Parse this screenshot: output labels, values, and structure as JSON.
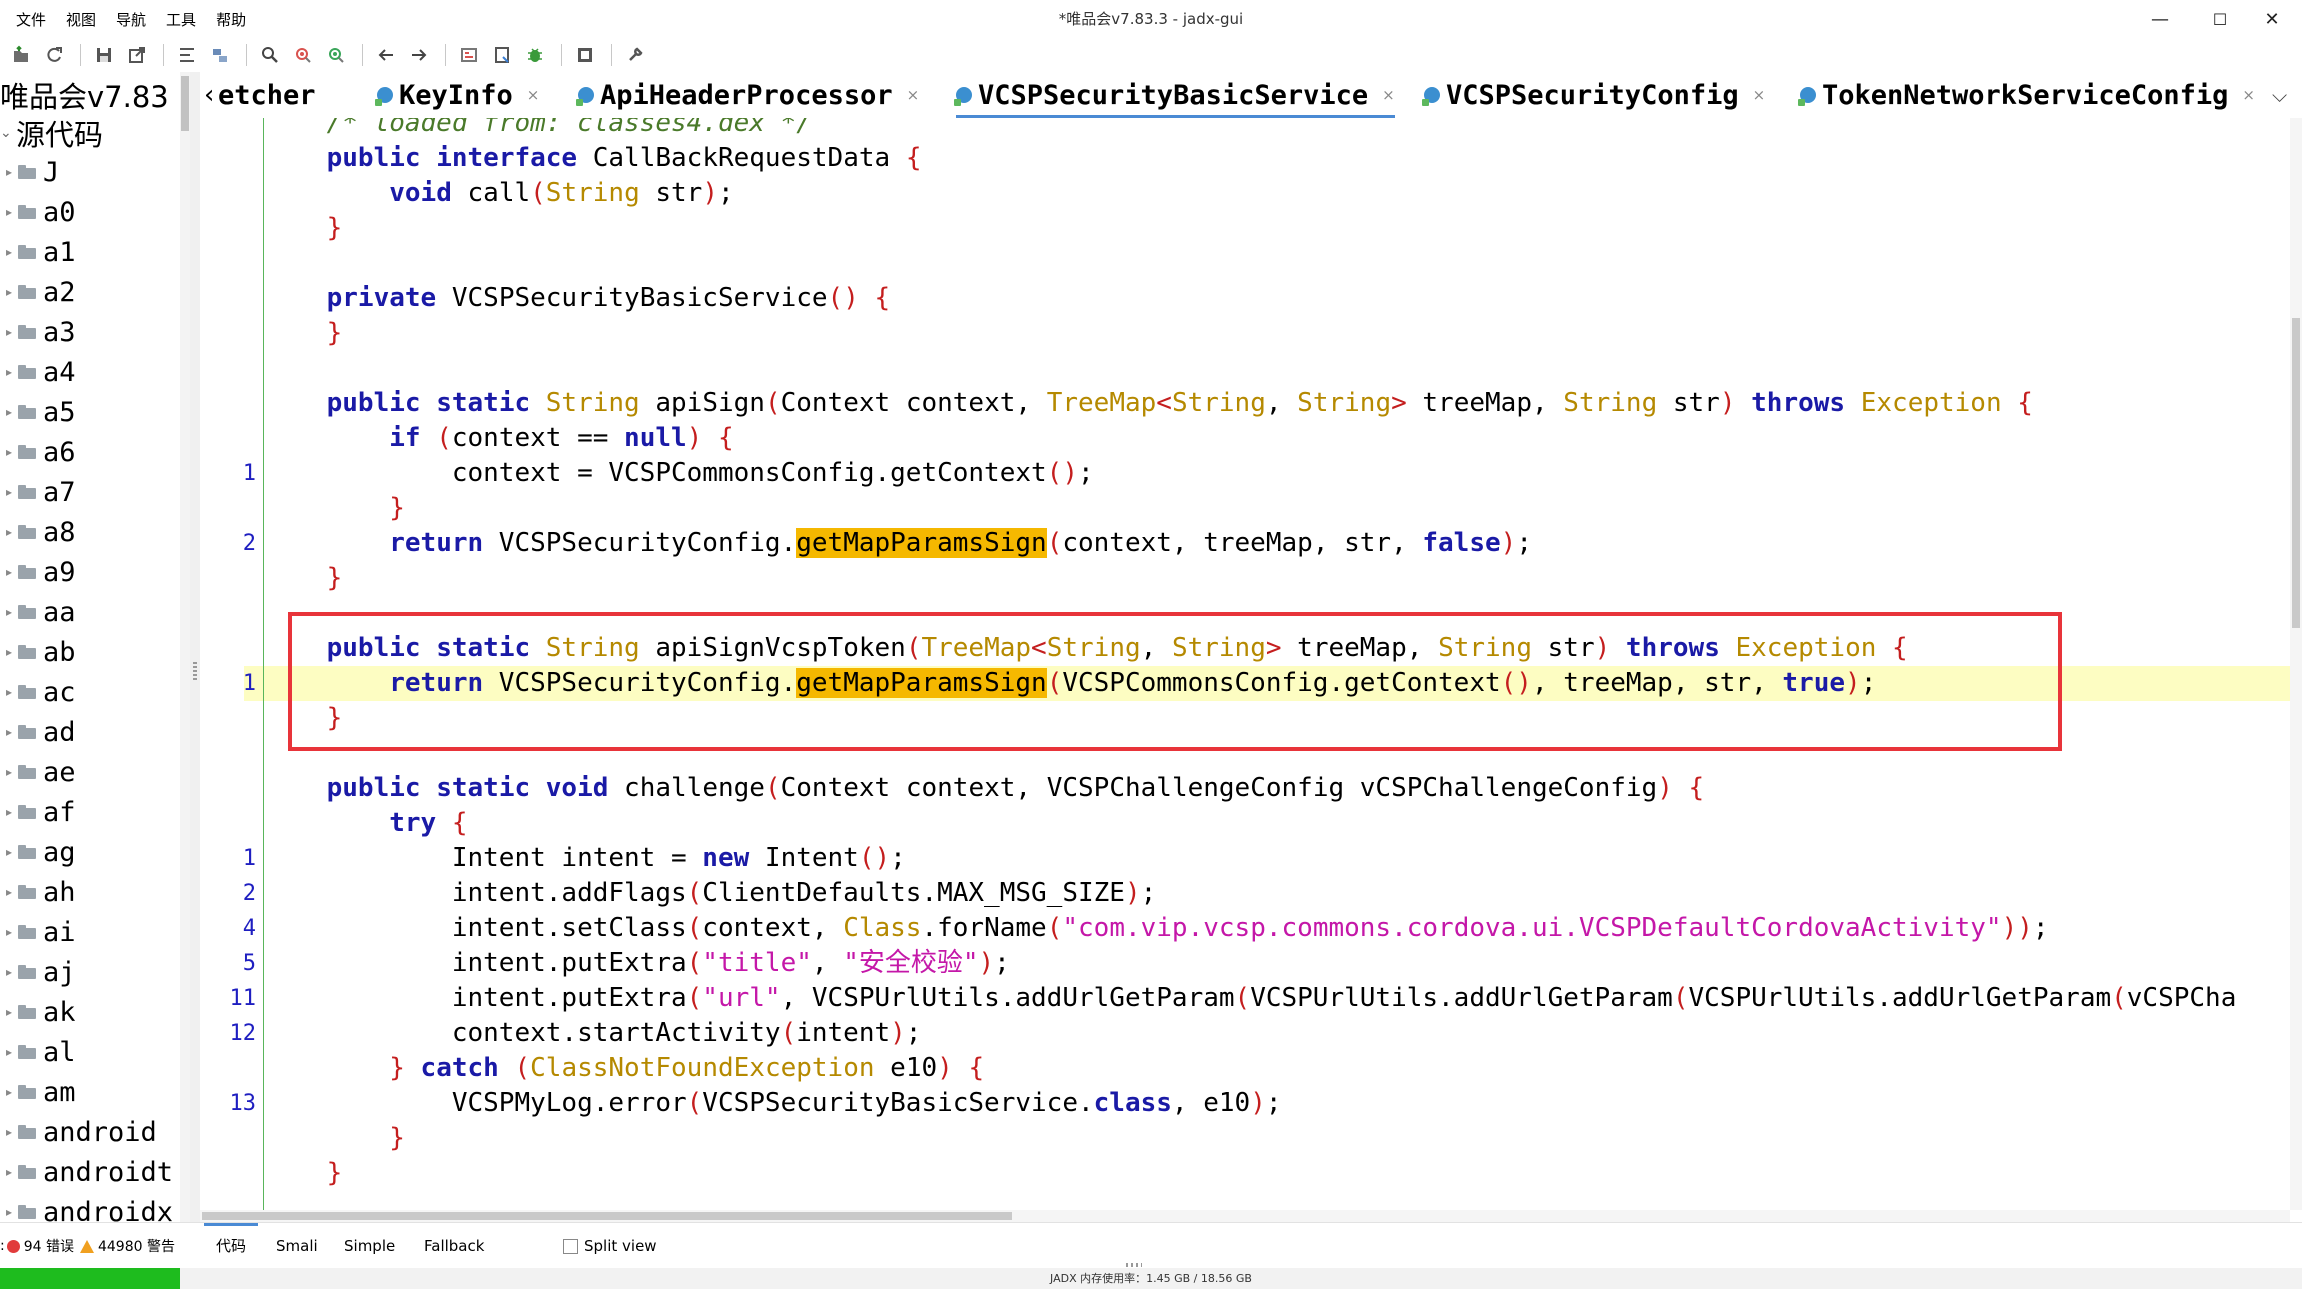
{
  "window": {
    "title": "*唯品会v7.83.3 - jadx-gui",
    "minimize": "—",
    "maximize": "☐",
    "close": "✕"
  },
  "menu": [
    "文件",
    "视图",
    "导航",
    "工具",
    "帮助"
  ],
  "toolbar_icons": [
    "open-file-icon",
    "refresh-icon",
    "save-icon",
    "export-icon",
    "sync-icon",
    "folder-tree-icon",
    "search-icon",
    "find-class-icon",
    "find-usage-icon",
    "back-icon",
    "forward-icon",
    "deobfuscation-icon",
    "decompile-all-icon",
    "debug-icon",
    "log-icon",
    "settings-icon"
  ],
  "tree": {
    "root": "唯品会v7.83",
    "source": "源代码",
    "items": [
      "J",
      "a0",
      "a1",
      "a2",
      "a3",
      "a4",
      "a5",
      "a6",
      "a7",
      "a8",
      "a9",
      "aa",
      "ab",
      "ac",
      "ad",
      "ae",
      "af",
      "ag",
      "ah",
      "ai",
      "aj",
      "ak",
      "al",
      "am",
      "android",
      "androidt",
      "androidx"
    ]
  },
  "tabs": {
    "scroll_left": "‹",
    "items": [
      {
        "label": "etcher",
        "icon": false,
        "close": false
      },
      {
        "label": "KeyInfo",
        "icon": true,
        "close": true
      },
      {
        "label": "ApiHeaderProcessor",
        "icon": true,
        "close": true
      },
      {
        "label": "VCSPSecurityBasicService",
        "icon": true,
        "close": true,
        "active": true
      },
      {
        "label": "VCSPSecurityConfig",
        "icon": true,
        "close": true
      },
      {
        "label": "TokenNetworkServiceConfig",
        "icon": true,
        "close": true
      }
    ],
    "close_glyph": "×",
    "dropdown": "⌵"
  },
  "code": {
    "lines": [
      {
        "ln": "",
        "segs": [
          [
            "cm",
            "    /* loaded from: classes4.dex */"
          ]
        ]
      },
      {
        "ln": "",
        "segs": [
          [
            "",
            "    "
          ],
          [
            "kw",
            "public"
          ],
          [
            "",
            " "
          ],
          [
            "kw",
            "interface"
          ],
          [
            "",
            " CallBackRequestData "
          ],
          [
            "pn",
            "{"
          ]
        ]
      },
      {
        "ln": "",
        "segs": [
          [
            "",
            "        "
          ],
          [
            "kw",
            "void"
          ],
          [
            "",
            " call"
          ],
          [
            "pn",
            "("
          ],
          [
            "ty",
            "String"
          ],
          [
            "",
            " str"
          ],
          [
            "pn",
            ")"
          ],
          [
            "",
            ";"
          ]
        ]
      },
      {
        "ln": "",
        "segs": [
          [
            "",
            "    "
          ],
          [
            "pn",
            "}"
          ]
        ]
      },
      {
        "ln": "",
        "segs": [
          [
            "",
            ""
          ]
        ]
      },
      {
        "ln": "",
        "segs": [
          [
            "",
            "    "
          ],
          [
            "kw",
            "private"
          ],
          [
            "",
            " VCSPSecurityBasicService"
          ],
          [
            "pn",
            "()"
          ],
          [
            "",
            " "
          ],
          [
            "pn",
            "{"
          ]
        ]
      },
      {
        "ln": "",
        "segs": [
          [
            "",
            "    "
          ],
          [
            "pn",
            "}"
          ]
        ]
      },
      {
        "ln": "",
        "segs": [
          [
            "",
            ""
          ]
        ]
      },
      {
        "ln": "",
        "segs": [
          [
            "",
            "    "
          ],
          [
            "kw",
            "public"
          ],
          [
            "",
            " "
          ],
          [
            "kw",
            "static"
          ],
          [
            "",
            " "
          ],
          [
            "ty",
            "String"
          ],
          [
            "",
            " apiSign"
          ],
          [
            "pn",
            "("
          ],
          [
            "",
            "Context context, "
          ],
          [
            "ty",
            "TreeMap"
          ],
          [
            "pn",
            "<"
          ],
          [
            "ty",
            "String"
          ],
          [
            "",
            ", "
          ],
          [
            "ty",
            "String"
          ],
          [
            "pn",
            ">"
          ],
          [
            "",
            " treeMap, "
          ],
          [
            "ty",
            "String"
          ],
          [
            "",
            " str"
          ],
          [
            "pn",
            ")"
          ],
          [
            "",
            " "
          ],
          [
            "kw",
            "throws"
          ],
          [
            "",
            " "
          ],
          [
            "ty",
            "Exception"
          ],
          [
            "",
            " "
          ],
          [
            "pn",
            "{"
          ]
        ]
      },
      {
        "ln": "",
        "segs": [
          [
            "",
            "        "
          ],
          [
            "kw",
            "if"
          ],
          [
            "",
            " "
          ],
          [
            "pn",
            "("
          ],
          [
            "",
            "context == "
          ],
          [
            "kw",
            "null"
          ],
          [
            "pn",
            ")"
          ],
          [
            "",
            " "
          ],
          [
            "pn",
            "{"
          ]
        ]
      },
      {
        "ln": "1",
        "segs": [
          [
            "",
            "            context = VCSPCommonsConfig.getContext"
          ],
          [
            "pn",
            "()"
          ],
          [
            "",
            ";"
          ]
        ]
      },
      {
        "ln": "",
        "segs": [
          [
            "",
            "        "
          ],
          [
            "pn",
            "}"
          ]
        ]
      },
      {
        "ln": "2",
        "segs": [
          [
            "",
            "        "
          ],
          [
            "kw",
            "return"
          ],
          [
            "",
            " VCSPSecurityConfig."
          ],
          [
            "match",
            "getMapParamsSign"
          ],
          [
            "pn",
            "("
          ],
          [
            "",
            "context, treeMap, str, "
          ],
          [
            "kw",
            "false"
          ],
          [
            "pn",
            ")"
          ],
          [
            "",
            ";"
          ]
        ]
      },
      {
        "ln": "",
        "segs": [
          [
            "",
            "    "
          ],
          [
            "pn",
            "}"
          ]
        ]
      },
      {
        "ln": "",
        "segs": [
          [
            "",
            ""
          ]
        ]
      },
      {
        "ln": "",
        "segs": [
          [
            "",
            "    "
          ],
          [
            "kw",
            "public"
          ],
          [
            "",
            " "
          ],
          [
            "kw",
            "static"
          ],
          [
            "",
            " "
          ],
          [
            "ty",
            "String"
          ],
          [
            "",
            " apiSignVcspToken"
          ],
          [
            "pn",
            "("
          ],
          [
            "ty",
            "TreeMap"
          ],
          [
            "pn",
            "<"
          ],
          [
            "ty",
            "String"
          ],
          [
            "",
            ", "
          ],
          [
            "ty",
            "String"
          ],
          [
            "pn",
            ">"
          ],
          [
            "",
            " treeMap, "
          ],
          [
            "ty",
            "String"
          ],
          [
            "",
            " str"
          ],
          [
            "pn",
            ")"
          ],
          [
            "",
            " "
          ],
          [
            "kw",
            "throws"
          ],
          [
            "",
            " "
          ],
          [
            "ty",
            "Exception"
          ],
          [
            "",
            " "
          ],
          [
            "pn",
            "{"
          ]
        ]
      },
      {
        "ln": "1",
        "hl": true,
        "segs": [
          [
            "",
            "        "
          ],
          [
            "kw",
            "return"
          ],
          [
            "",
            " VCSPSecurityConfig."
          ],
          [
            "match",
            "getMapParamsSign"
          ],
          [
            "pn",
            "("
          ],
          [
            "",
            "VCSPCommonsConfig.getContext"
          ],
          [
            "pn",
            "()"
          ],
          [
            "",
            ", treeMap, str, "
          ],
          [
            "kw",
            "true"
          ],
          [
            "pn",
            ")"
          ],
          [
            "",
            ";"
          ]
        ]
      },
      {
        "ln": "",
        "segs": [
          [
            "",
            "    "
          ],
          [
            "pn",
            "}"
          ]
        ]
      },
      {
        "ln": "",
        "segs": [
          [
            "",
            ""
          ]
        ]
      },
      {
        "ln": "",
        "segs": [
          [
            "",
            "    "
          ],
          [
            "kw",
            "public"
          ],
          [
            "",
            " "
          ],
          [
            "kw",
            "static"
          ],
          [
            "",
            " "
          ],
          [
            "kw",
            "void"
          ],
          [
            "",
            " challenge"
          ],
          [
            "pn",
            "("
          ],
          [
            "",
            "Context context, VCSPChallengeConfig vCSPChallengeConfig"
          ],
          [
            "pn",
            ")"
          ],
          [
            "",
            " "
          ],
          [
            "pn",
            "{"
          ]
        ]
      },
      {
        "ln": "",
        "segs": [
          [
            "",
            "        "
          ],
          [
            "kw",
            "try"
          ],
          [
            "",
            " "
          ],
          [
            "pn",
            "{"
          ]
        ]
      },
      {
        "ln": "1",
        "segs": [
          [
            "",
            "            Intent intent = "
          ],
          [
            "kw",
            "new"
          ],
          [
            "",
            " Intent"
          ],
          [
            "pn",
            "()"
          ],
          [
            "",
            ";"
          ]
        ]
      },
      {
        "ln": "2",
        "segs": [
          [
            "",
            "            intent.addFlags"
          ],
          [
            "pn",
            "("
          ],
          [
            "",
            "ClientDefaults.MAX_MSG_SIZE"
          ],
          [
            "pn",
            ")"
          ],
          [
            "",
            ";"
          ]
        ]
      },
      {
        "ln": "4",
        "segs": [
          [
            "",
            "            intent.setClass"
          ],
          [
            "pn",
            "("
          ],
          [
            "",
            "context, "
          ],
          [
            "ty",
            "Class"
          ],
          [
            "",
            ".forName"
          ],
          [
            "pn",
            "("
          ],
          [
            "st",
            "\"com.vip.vcsp.commons.cordova.ui.VCSPDefaultCordovaActivity\""
          ],
          [
            "pn",
            "))"
          ],
          [
            "",
            ";"
          ]
        ]
      },
      {
        "ln": "5",
        "segs": [
          [
            "",
            "            intent.putExtra"
          ],
          [
            "pn",
            "("
          ],
          [
            "st",
            "\"title\""
          ],
          [
            "",
            ", "
          ],
          [
            "st",
            "\"安全校验\""
          ],
          [
            "pn",
            ")"
          ],
          [
            "",
            ";"
          ]
        ]
      },
      {
        "ln": "11",
        "segs": [
          [
            "",
            "            intent.putExtra"
          ],
          [
            "pn",
            "("
          ],
          [
            "st",
            "\"url\""
          ],
          [
            "",
            ", VCSPUrlUtils.addUrlGetParam"
          ],
          [
            "pn",
            "("
          ],
          [
            "",
            "VCSPUrlUtils.addUrlGetParam"
          ],
          [
            "pn",
            "("
          ],
          [
            "",
            "VCSPUrlUtils.addUrlGetParam"
          ],
          [
            "pn",
            "("
          ],
          [
            "",
            "vCSPCha"
          ]
        ]
      },
      {
        "ln": "12",
        "segs": [
          [
            "",
            "            context.startActivity"
          ],
          [
            "pn",
            "("
          ],
          [
            "",
            "intent"
          ],
          [
            "pn",
            ")"
          ],
          [
            "",
            ";"
          ]
        ]
      },
      {
        "ln": "",
        "segs": [
          [
            "",
            "        "
          ],
          [
            "pn",
            "}"
          ],
          [
            "",
            " "
          ],
          [
            "kw",
            "catch"
          ],
          [
            "",
            " "
          ],
          [
            "pn",
            "("
          ],
          [
            "ty",
            "ClassNotFoundException"
          ],
          [
            "",
            " e10"
          ],
          [
            "pn",
            ")"
          ],
          [
            "",
            " "
          ],
          [
            "pn",
            "{"
          ]
        ]
      },
      {
        "ln": "13",
        "segs": [
          [
            "",
            "            VCSPMyLog.error"
          ],
          [
            "pn",
            "("
          ],
          [
            "",
            "VCSPSecurityBasicService."
          ],
          [
            "kw",
            "class"
          ],
          [
            "",
            ", e10"
          ],
          [
            "pn",
            ")"
          ],
          [
            "",
            ";"
          ]
        ]
      },
      {
        "ln": "",
        "segs": [
          [
            "",
            "        "
          ],
          [
            "pn",
            "}"
          ]
        ]
      },
      {
        "ln": "",
        "segs": [
          [
            "",
            "    "
          ],
          [
            "pn",
            "}"
          ]
        ]
      }
    ]
  },
  "status": {
    "prefix": ":",
    "errors": "94 错误",
    "warnings": "44980 警告"
  },
  "view_tabs": [
    "代码",
    "Smali",
    "Simple",
    "Fallback"
  ],
  "split_view": "Split view",
  "memory": {
    "text": "JADX 内存使用率：1.45 GB / 18.56 GB",
    "fraction": 0.078
  }
}
